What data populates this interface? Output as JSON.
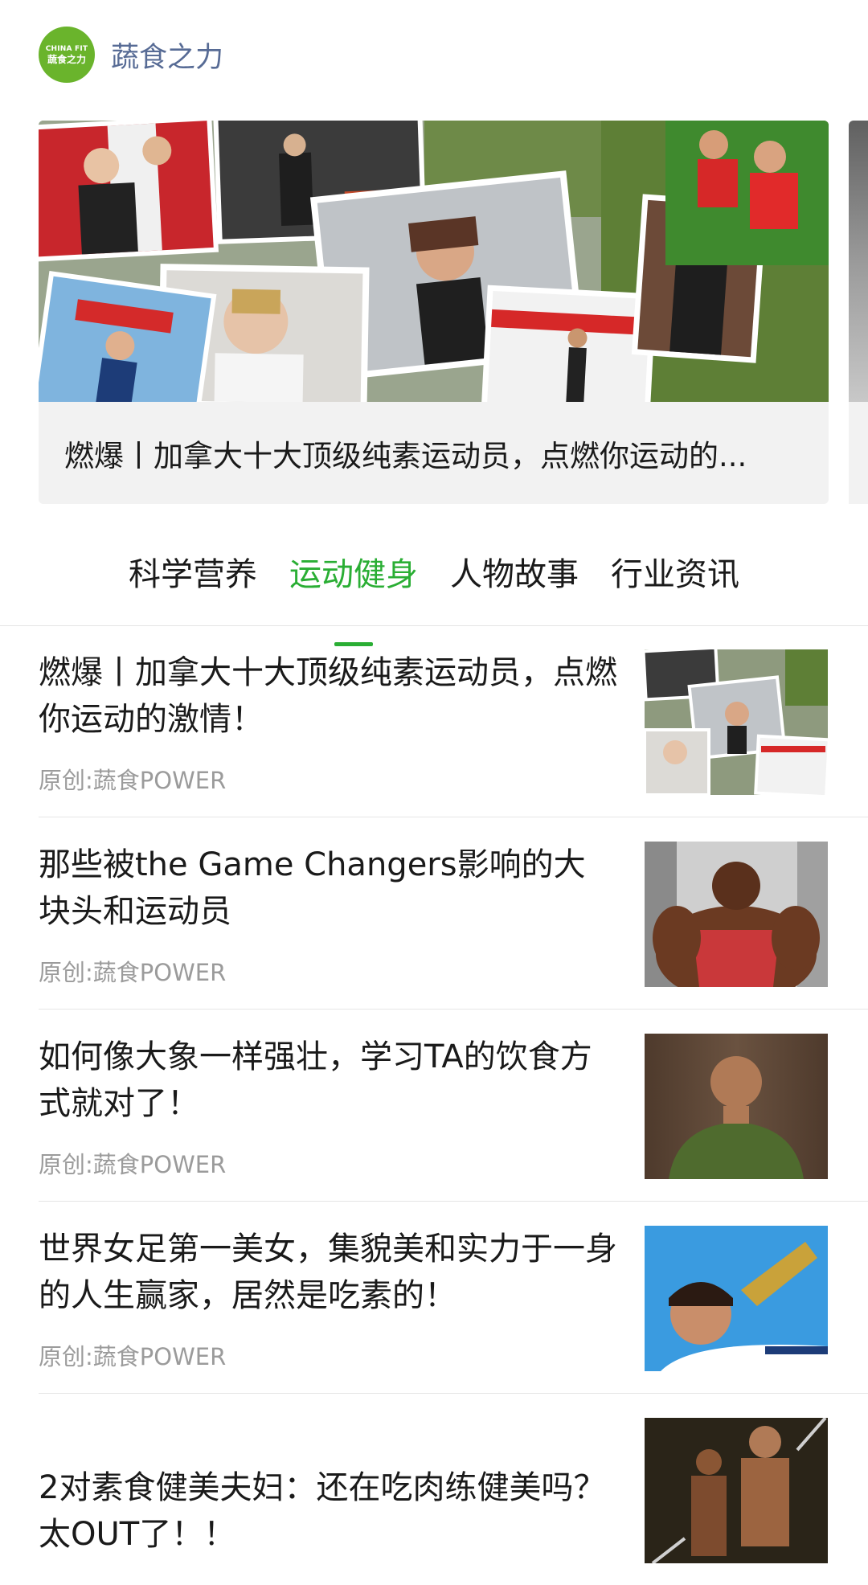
{
  "header": {
    "logo_line1": "CHINA FIT",
    "logo_line2": "蔬食之力",
    "brand_name": "蔬食之力"
  },
  "banner": {
    "caption": "燃爆丨加拿大十大顶级纯素运动员，点燃你运动的..."
  },
  "tabs": [
    {
      "label": "科学营养",
      "active": false
    },
    {
      "label": "运动健身",
      "active": true
    },
    {
      "label": "人物故事",
      "active": false
    },
    {
      "label": "行业资讯",
      "active": false
    }
  ],
  "articles": [
    {
      "title": "燃爆丨加拿大十大顶级纯素运动员，点燃你运动的激情！",
      "source": "原创:蔬食POWER",
      "thumb": "athlete-collage-image"
    },
    {
      "title": "那些被the Game Changers影响的大块头和运动员",
      "source": "原创:蔬食POWER",
      "thumb": "bodybuilder-image"
    },
    {
      "title": "如何像大象一样强壮，学习TA的饮食方式就对了！",
      "source": "原创:蔬食POWER",
      "thumb": "athlete-portrait-image"
    },
    {
      "title": "世界女足第一美女，集貌美和实力于一身的人生赢家，居然是吃素的！",
      "source": "原创:蔬食POWER",
      "thumb": "soccer-player-image"
    },
    {
      "title": "2对素食健美夫妇：还在吃肉练健美吗？太OUT了！！",
      "source": "",
      "thumb": "bodybuilder-couple-image"
    }
  ],
  "colors": {
    "accent_green": "#2aae34",
    "logo_green": "#6ab42c",
    "brand_blue": "#576b95",
    "meta_gray": "#9b9b9b"
  }
}
